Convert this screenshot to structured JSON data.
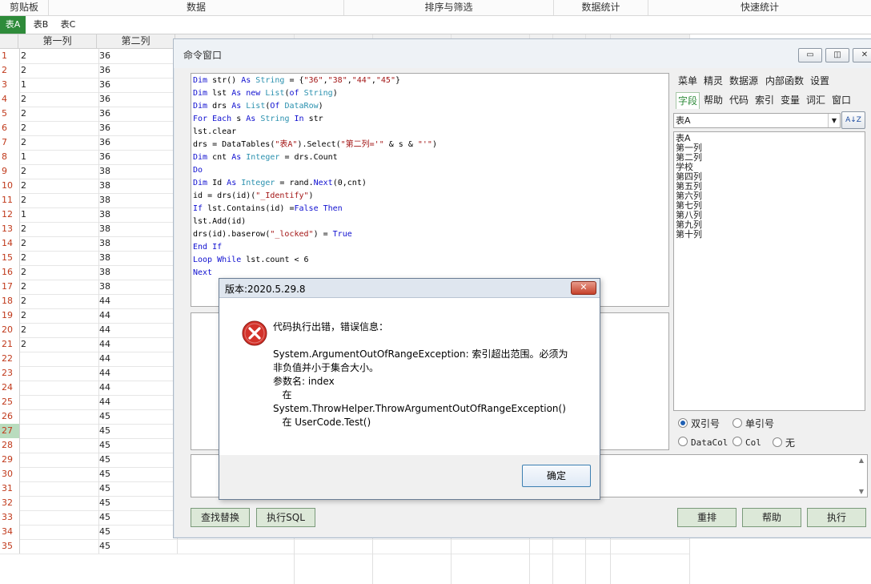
{
  "ribbon_groups": [
    "剪贴板",
    "数据",
    "排序与筛选",
    "数据统计",
    "快速统计"
  ],
  "sheet_tabs": [
    "表A",
    "表B",
    "表C"
  ],
  "grid": {
    "col_headers": [
      "第一列",
      "第二列"
    ],
    "row_numbers": [
      "1",
      "2",
      "3",
      "4",
      "5",
      "6",
      "7",
      "8",
      "9",
      "10",
      "11",
      "12",
      "13",
      "14",
      "15",
      "16",
      "17",
      "18",
      "19",
      "20",
      "21",
      "22",
      "23",
      "24",
      "25",
      "26",
      "27",
      "28",
      "29",
      "30",
      "31",
      "32",
      "33",
      "34",
      "35"
    ],
    "col1": [
      "2",
      "2",
      "1",
      "2",
      "2",
      "2",
      "2",
      "1",
      "2",
      "2",
      "2",
      "1",
      "2",
      "2",
      "2",
      "2",
      "2",
      "2",
      "2",
      "2",
      "2",
      "",
      "",
      "",
      "",
      "",
      "",
      "",
      "",
      "",
      "",
      "",
      "",
      "",
      ""
    ],
    "col2": [
      "36",
      "36",
      "36",
      "36",
      "36",
      "36",
      "36",
      "36",
      "38",
      "38",
      "38",
      "38",
      "38",
      "38",
      "38",
      "38",
      "38",
      "44",
      "44",
      "44",
      "44",
      "44",
      "44",
      "44",
      "44",
      "45",
      "45",
      "45",
      "45",
      "45",
      "45",
      "45",
      "45",
      "45",
      "45"
    ]
  },
  "command_window": {
    "title": "命令窗口",
    "win_buttons": [
      "▭",
      "◫",
      "✕"
    ],
    "code_lines": [
      "Dim str() As String = {\"36\",\"38\",\"44\",\"45\"}",
      "Dim lst As new List(of String)",
      "Dim drs As List(Of DataRow)",
      "For Each s As String In str",
      "lst.clear",
      "drs = DataTables(\"表A\").Select(\"第二列='\" & s & \"'\")",
      "Dim cnt As Integer = drs.Count",
      "Do",
      "Dim Id As Integer = rand.Next(0,cnt)",
      "id = drs(id)(\"_Identify\")",
      "If lst.Contains(id) =False Then",
      "lst.Add(id)",
      "drs(id).baserow(\"_locked\") = True",
      "End If",
      "Loop While lst.count < 6",
      "Next"
    ],
    "right_menu_row1": [
      "菜单",
      "精灵",
      "数据源",
      "内部函数",
      "设置"
    ],
    "right_menu_row2": [
      "字段",
      "帮助",
      "代码",
      "索引",
      "变量",
      "词汇",
      "窗口"
    ],
    "table_select": "表A",
    "sort_button": "A↓Z",
    "fields": [
      "表A",
      "第一列",
      "第二列",
      "学校",
      "第四列",
      "第五列",
      "第六列",
      "第七列",
      "第八列",
      "第九列",
      "第十列"
    ],
    "quote_options": [
      "双引号",
      "单引号"
    ],
    "col_options": [
      "DataCol",
      "Col",
      "无"
    ],
    "buttons_left": [
      "查找替换",
      "执行SQL"
    ],
    "buttons_right": [
      "重排",
      "帮助",
      "执行"
    ]
  },
  "error_dialog": {
    "title": "版本:2020.5.29.8",
    "close_label": "✕",
    "message": "代码执行出错，错误信息：\n\nSystem.ArgumentOutOfRangeException: 索引超出范围。必须为非负值并小于集合大小。\n参数名: index\n   在\nSystem.ThrowHelper.ThrowArgumentOutOfRangeException()\n   在 UserCode.Test()",
    "ok_label": "确定",
    "icon": "error-icon"
  }
}
